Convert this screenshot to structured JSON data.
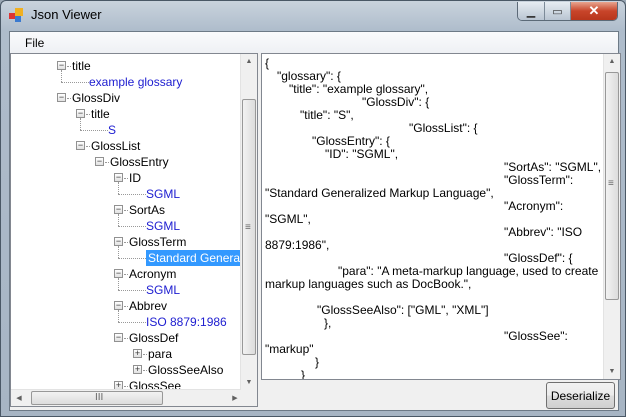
{
  "window": {
    "title": "Json Viewer",
    "icon": "app-icon",
    "controls": [
      "minimize",
      "maximize",
      "close"
    ]
  },
  "menu": {
    "file": "File"
  },
  "tree": {
    "rows": [
      {
        "label": "title",
        "level": 0,
        "type": "node",
        "state": "expanded"
      },
      {
        "label": "example glossary",
        "level": 1,
        "type": "leaf"
      },
      {
        "label": "GlossDiv",
        "level": 0,
        "type": "node",
        "state": "expanded"
      },
      {
        "label": "title",
        "level": 1,
        "type": "node",
        "state": "expanded"
      },
      {
        "label": "S",
        "level": 2,
        "type": "leaf"
      },
      {
        "label": "GlossList",
        "level": 1,
        "type": "node",
        "state": "expanded"
      },
      {
        "label": "GlossEntry",
        "level": 2,
        "type": "node",
        "state": "expanded"
      },
      {
        "label": "ID",
        "level": 3,
        "type": "node",
        "state": "expanded"
      },
      {
        "label": "SGML",
        "level": 4,
        "type": "leaf"
      },
      {
        "label": "SortAs",
        "level": 3,
        "type": "node",
        "state": "expanded"
      },
      {
        "label": "SGML",
        "level": 4,
        "type": "leaf"
      },
      {
        "label": "GlossTerm",
        "level": 3,
        "type": "node",
        "state": "expanded"
      },
      {
        "label": "Standard Generalized Markup Language",
        "level": 4,
        "type": "leaf",
        "selected": true
      },
      {
        "label": "Acronym",
        "level": 3,
        "type": "node",
        "state": "expanded"
      },
      {
        "label": "SGML",
        "level": 4,
        "type": "leaf"
      },
      {
        "label": "Abbrev",
        "level": 3,
        "type": "node",
        "state": "expanded"
      },
      {
        "label": "ISO 8879:1986",
        "level": 4,
        "type": "leaf"
      },
      {
        "label": "GlossDef",
        "level": 3,
        "type": "node",
        "state": "expanded"
      },
      {
        "label": "para",
        "level": 4,
        "type": "node",
        "state": "collapsed"
      },
      {
        "label": "GlossSeeAlso",
        "level": 4,
        "type": "node",
        "state": "collapsed"
      },
      {
        "label": "GlossSee",
        "level": 3,
        "type": "node",
        "state": "collapsed"
      }
    ]
  },
  "json_text": {
    "lines": [
      "{",
      "\"glossary\": {",
      "\"title\": \"example glossary\",",
      "\"GlossDiv\": {",
      "\"title\": \"S\",",
      "\"GlossList\": {",
      "\"GlossEntry\": {",
      "\"ID\": \"SGML\",",
      "\"SortAs\": \"SGML\",",
      "\"GlossTerm\":",
      "\"Standard Generalized Markup Language\",",
      "\"Acronym\":",
      "\"SGML\",",
      "\"Abbrev\": \"ISO",
      "8879:1986\",",
      "\"GlossDef\": {",
      "\"para\": \"A meta-markup language, used to create",
      "markup languages such as DocBook.\",",
      "\"GlossSeeAlso\": [\"GML\", \"XML\"]",
      "},",
      "\"GlossSee\":",
      "\"markup\"",
      "}",
      "}"
    ]
  },
  "buttons": {
    "deserialize": "Deserialize"
  },
  "colors": {
    "leaf_text": "#1d1dd0",
    "selection": "#3399ff",
    "close_button": "#c8452a"
  }
}
